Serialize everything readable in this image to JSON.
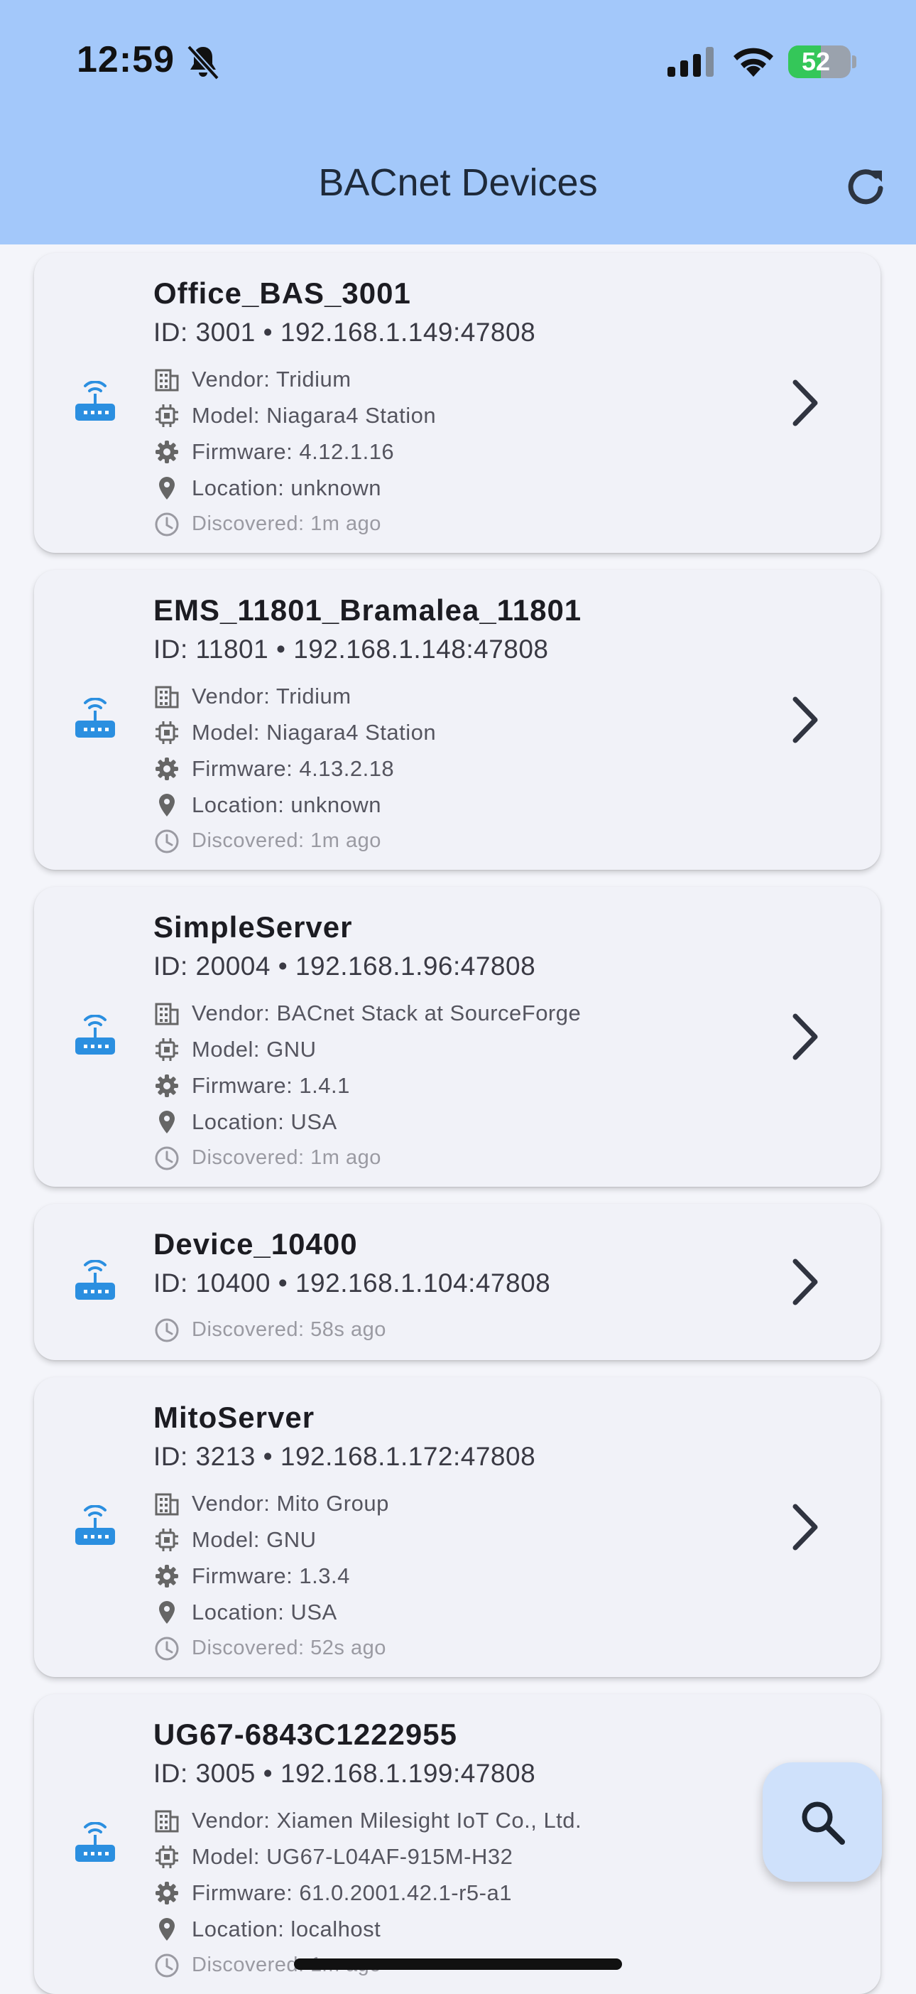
{
  "status_bar": {
    "time": "12:59",
    "battery_percent": "52",
    "battery_level": 0.52,
    "icons": [
      "bell-slash-icon",
      "cellular-signal-icon",
      "wifi-icon",
      "battery-charging-icon"
    ]
  },
  "app_bar": {
    "title": "BACnet Devices",
    "refresh_icon": "refresh-icon"
  },
  "devices": [
    {
      "name": "Office_BAS_3001",
      "id_line": "ID: 3001 • 192.168.1.149:47808",
      "vendor": "Vendor: Tridium",
      "model": "Model: Niagara4 Station",
      "firmware": "Firmware: 4.12.1.16",
      "location": "Location: unknown",
      "discovered": "Discovered: 1m ago"
    },
    {
      "name": "EMS_11801_Bramalea_11801",
      "id_line": "ID: 11801 • 192.168.1.148:47808",
      "vendor": "Vendor: Tridium",
      "model": "Model: Niagara4 Station",
      "firmware": "Firmware: 4.13.2.18",
      "location": "Location: unknown",
      "discovered": "Discovered: 1m ago"
    },
    {
      "name": "SimpleServer",
      "id_line": "ID: 20004 • 192.168.1.96:47808",
      "vendor": "Vendor: BACnet Stack at SourceForge",
      "model": "Model: GNU",
      "firmware": "Firmware: 1.4.1",
      "location": "Location: USA",
      "discovered": "Discovered: 1m ago"
    },
    {
      "name": "Device_10400",
      "id_line": "ID: 10400 • 192.168.1.104:47808",
      "discovered": "Discovered: 58s ago"
    },
    {
      "name": "MitoServer",
      "id_line": "ID: 3213 • 192.168.1.172:47808",
      "vendor": "Vendor: Mito Group",
      "model": "Model: GNU",
      "firmware": "Firmware: 1.3.4",
      "location": "Location: USA",
      "discovered": "Discovered: 52s ago"
    },
    {
      "name": "UG67-6843C1222955",
      "id_line": "ID: 3005 • 192.168.1.199:47808",
      "vendor": "Vendor: Xiamen Milesight IoT Co., Ltd.",
      "model": "Model: UG67-L04AF-915M-H32",
      "firmware": "Firmware: 61.0.2001.42.1-r5-a1",
      "location": "Location: localhost",
      "discovered": "Discovered: 1m ago"
    }
  ],
  "fab": {
    "icon": "search-icon"
  },
  "colors": {
    "app_bar": "#a3c8fa",
    "router_icon": "#2b8fe0",
    "card": "#f1f2f8",
    "fab": "#cfe1fb"
  }
}
